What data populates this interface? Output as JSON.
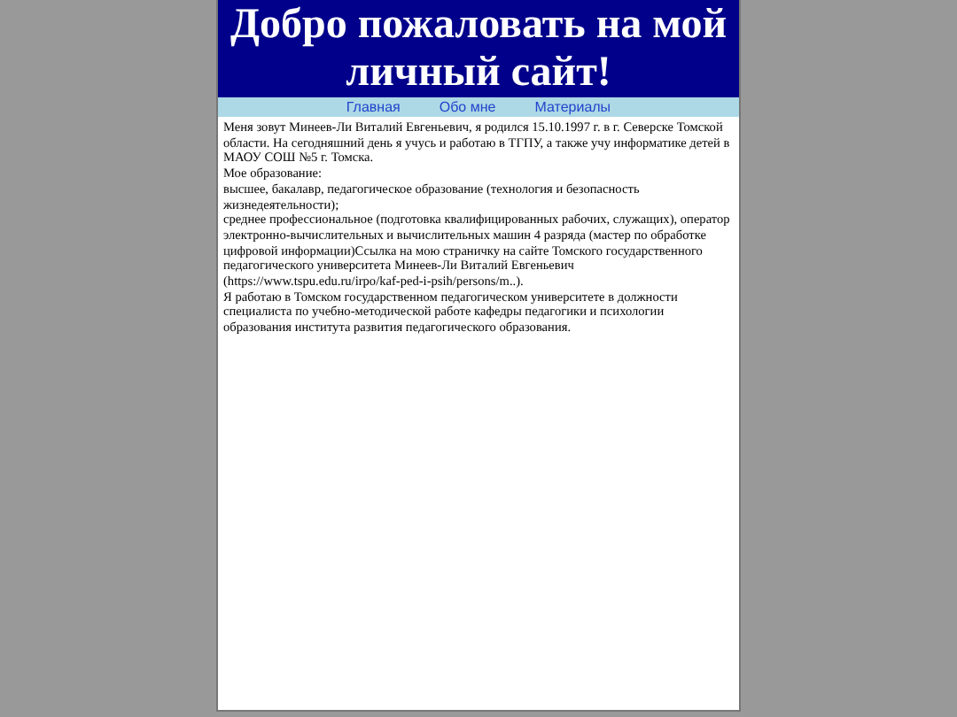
{
  "header": {
    "title": "Добро пожаловать на мой личный сайт!"
  },
  "nav": [
    {
      "label": "Главная"
    },
    {
      "label": "Обо мне"
    },
    {
      "label": "Материалы"
    }
  ],
  "paragraphs": [
    "Меня зовут Минеев-Ли Виталий Евгеньевич, я родился 15.10.1997 г. в г. Северске Томской области. На сегодняшний день я учусь и работаю в ТГПУ, а также учу информатике детей в МАОУ СОШ №5 г. Томска.",
    "Мое образование:",
    "высшее, бакалавр, педагогическое образование (технология и безопасность жизнедеятельности);",
    "среднее профессиональное (подготовка квалифицированных рабочих, служащих), оператор электронно-вычислительных и вычислительных машин 4 разряда (мастер по обработке цифровой информации)Ссылка на мою страничку на сайте Томского государственного педагогического университета Минеев-Ли Виталий Евгеньевич (https://www.tspu.edu.ru/irpo/kaf-ped-i-psih/persons/m..).",
    "Я работаю в Томском государственном педагогическом университете в должности специалиста по учебно-методической работе кафедры педагогики и психологии образования института развития педагогического образования."
  ]
}
